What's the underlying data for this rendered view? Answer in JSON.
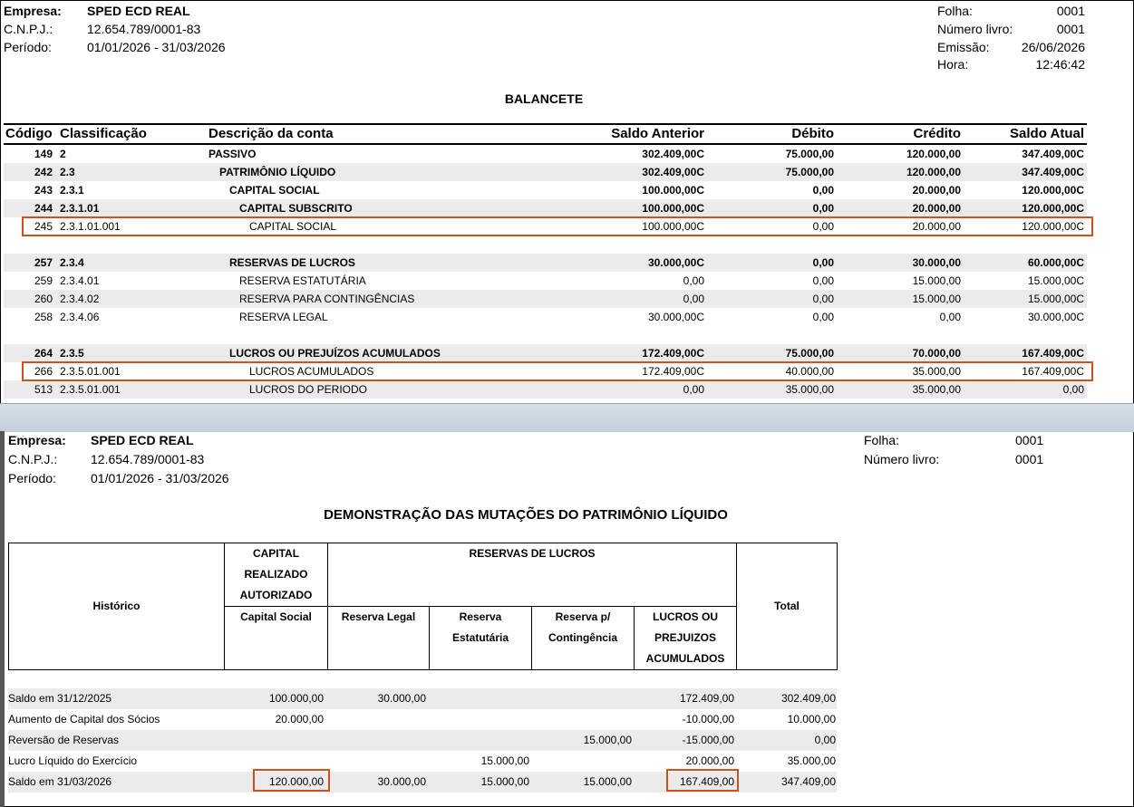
{
  "top": {
    "empresa_label": "Empresa:",
    "empresa": "SPED ECD REAL",
    "cnpj_label": "C.N.P.J.:",
    "cnpj": "12.654.789/0001-83",
    "periodo_label": "Período:",
    "periodo": "01/01/2026 - 31/03/2026",
    "folha_label": "Folha:",
    "folha": "0001",
    "livro_label": "Número livro:",
    "livro": "0001",
    "emissao_label": "Emissão:",
    "emissao": "26/06/2026",
    "hora_label": "Hora:",
    "hora": "12:46:42",
    "title": "BALANCETE"
  },
  "balancete": {
    "headers": [
      "Código",
      "Classificação",
      "Descrição da conta",
      "Saldo Anterior",
      "Débito",
      "Crédito",
      "Saldo Atual"
    ],
    "rows": [
      {
        "cod": "149",
        "cls": "2",
        "desc": "PASSIVO",
        "ant": "302.409,00C",
        "deb": "75.000,00",
        "cred": "120.000,00",
        "atual": "347.409,00C",
        "bold": true,
        "level": 0,
        "shade": false
      },
      {
        "cod": "242",
        "cls": "2.3",
        "desc": "PATRIMÔNIO LÍQUIDO",
        "ant": "302.409,00C",
        "deb": "75.000,00",
        "cred": "120.000,00",
        "atual": "347.409,00C",
        "bold": true,
        "level": 1,
        "shade": true
      },
      {
        "cod": "243",
        "cls": "2.3.1",
        "desc": "CAPITAL SOCIAL",
        "ant": "100.000,00C",
        "deb": "0,00",
        "cred": "20.000,00",
        "atual": "120.000,00C",
        "bold": true,
        "level": 2,
        "shade": false
      },
      {
        "cod": "244",
        "cls": "2.3.1.01",
        "desc": "CAPITAL SUBSCRITO",
        "ant": "100.000,00C",
        "deb": "0,00",
        "cred": "20.000,00",
        "atual": "120.000,00C",
        "bold": true,
        "level": 3,
        "shade": true
      },
      {
        "cod": "245",
        "cls": "2.3.1.01.001",
        "desc": "CAPITAL SOCIAL",
        "ant": "100.000,00C",
        "deb": "0,00",
        "cred": "20.000,00",
        "atual": "120.000,00C",
        "bold": false,
        "level": 4,
        "shade": false
      },
      null,
      {
        "cod": "257",
        "cls": "2.3.4",
        "desc": "RESERVAS DE LUCROS",
        "ant": "30.000,00C",
        "deb": "0,00",
        "cred": "30.000,00",
        "atual": "60.000,00C",
        "bold": true,
        "level": 2,
        "shade": true
      },
      {
        "cod": "259",
        "cls": "2.3.4.01",
        "desc": "RESERVA ESTATUTÁRIA",
        "ant": "0,00",
        "deb": "0,00",
        "cred": "15.000,00",
        "atual": "15.000,00C",
        "bold": false,
        "level": 3,
        "shade": false
      },
      {
        "cod": "260",
        "cls": "2.3.4.02",
        "desc": "RESERVA PARA CONTINGÊNCIAS",
        "ant": "0,00",
        "deb": "0,00",
        "cred": "15.000,00",
        "atual": "15.000,00C",
        "bold": false,
        "level": 3,
        "shade": true
      },
      {
        "cod": "258",
        "cls": "2.3.4.06",
        "desc": "RESERVA LEGAL",
        "ant": "30.000,00C",
        "deb": "0,00",
        "cred": "0,00",
        "atual": "30.000,00C",
        "bold": false,
        "level": 3,
        "shade": false
      },
      null,
      {
        "cod": "264",
        "cls": "2.3.5",
        "desc": "LUCROS OU PREJUÍZOS ACUMULADOS",
        "ant": "172.409,00C",
        "deb": "75.000,00",
        "cred": "70.000,00",
        "atual": "167.409,00C",
        "bold": true,
        "level": 2,
        "shade": true
      },
      {
        "cod": "266",
        "cls": "2.3.5.01.001",
        "desc": "LUCROS ACUMULADOS",
        "ant": "172.409,00C",
        "deb": "40.000,00",
        "cred": "35.000,00",
        "atual": "167.409,00C",
        "bold": false,
        "level": 4,
        "shade": false
      },
      {
        "cod": "513",
        "cls": "2.3.5.01.001",
        "desc": "LUCROS DO PERIODO",
        "ant": "0,00",
        "deb": "35.000,00",
        "cred": "35.000,00",
        "atual": "0,00",
        "bold": false,
        "level": 4,
        "shade": true
      }
    ]
  },
  "bottom": {
    "empresa_label": "Empresa:",
    "empresa": "SPED ECD REAL",
    "cnpj_label": "C.N.P.J.:",
    "cnpj": "12.654.789/0001-83",
    "periodo_label": "Período:",
    "periodo": "01/01/2026 - 31/03/2026",
    "folha_label": "Folha:",
    "folha": "0001",
    "livro_label": "Número livro:",
    "livro": "0001",
    "title": "DEMONSTRAÇÃO DAS MUTAÇÕES DO PATRIMÔNIO LÍQUIDO"
  },
  "dmpl": {
    "h_historico": "Histórico",
    "h_capital_1": "CAPITAL",
    "h_capital_2": "REALIZADO",
    "h_capital_3": "AUTORIZADO",
    "h_capital_social": "Capital Social",
    "h_reservas": "RESERVAS DE LUCROS",
    "h_res_legal": "Reserva Legal",
    "h_res_est_1": "Reserva",
    "h_res_est_2": "Estatutária",
    "h_res_cont_1": "Reserva p/",
    "h_res_cont_2": "Contingência",
    "h_lucros_1": "LUCROS OU",
    "h_lucros_2": "PREJUIZOS",
    "h_lucros_3": "ACUMULADOS",
    "h_total": "Total",
    "rows": [
      {
        "hist": "Saldo em 31/12/2025",
        "cap": "100.000,00",
        "leg": "30.000,00",
        "est": "",
        "cont": "",
        "luc": "172.409,00",
        "tot": "302.409,00",
        "shade": true
      },
      {
        "hist": "Aumento de Capital dos Sócios",
        "cap": "20.000,00",
        "leg": "",
        "est": "",
        "cont": "",
        "luc": "-10.000,00",
        "tot": "10.000,00",
        "shade": false
      },
      {
        "hist": "Reversão de Reservas",
        "cap": "",
        "leg": "",
        "est": "",
        "cont": "15.000,00",
        "luc": "-15.000,00",
        "tot": "0,00",
        "shade": true
      },
      {
        "hist": "Lucro Líquido do Exercício",
        "cap": "",
        "leg": "",
        "est": "15.000,00",
        "cont": "",
        "luc": "20.000,00",
        "tot": "35.000,00",
        "shade": false
      },
      {
        "hist": "Saldo em 31/03/2026",
        "cap": "120.000,00",
        "leg": "30.000,00",
        "est": "15.000,00",
        "cont": "15.000,00",
        "luc": "167.409,00",
        "tot": "347.409,00",
        "shade": true
      }
    ]
  }
}
